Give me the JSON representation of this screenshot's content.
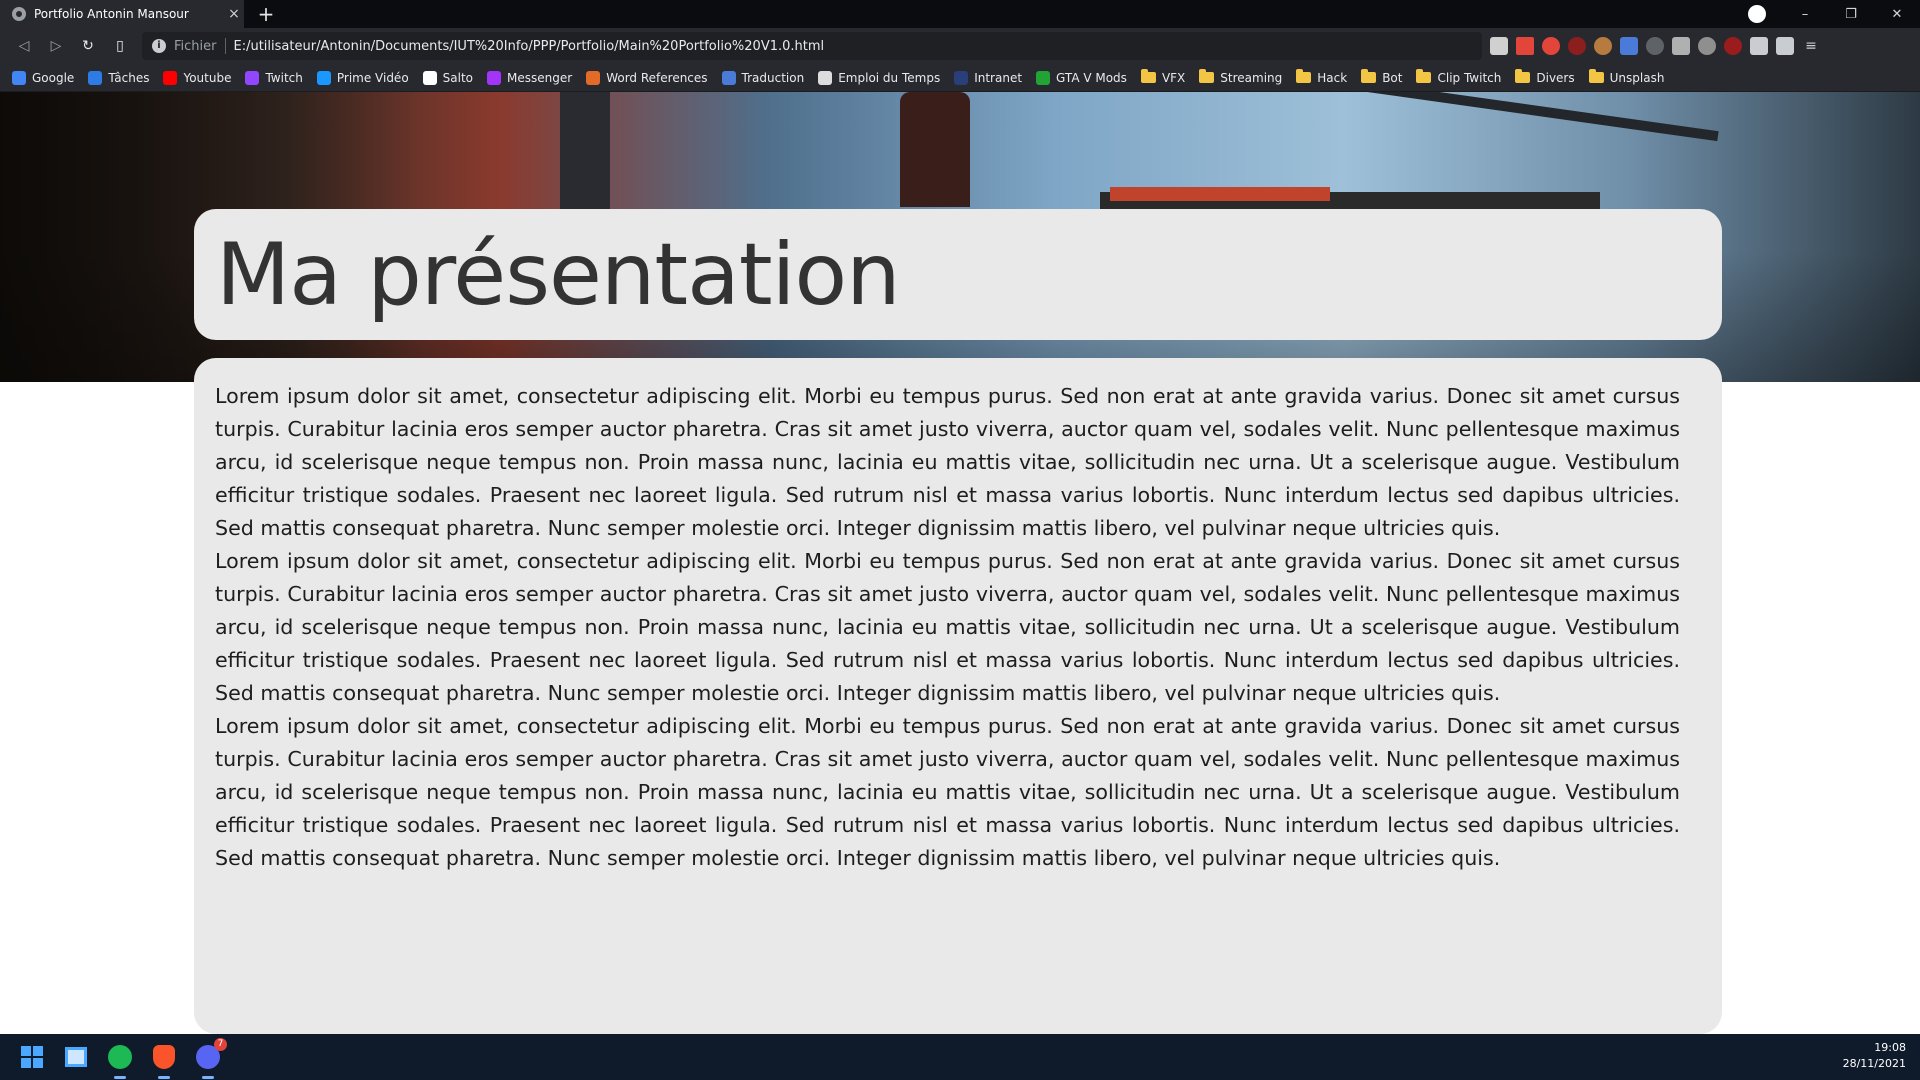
{
  "browser": {
    "tab_title": "Portfolio Antonin Mansour",
    "tab_close": "×",
    "new_tab": "+",
    "address_scheme": "Fichier",
    "address_url": "E:/utilisateur/Antonin/Documents/IUT%20Info/PPP/Portfolio/Main%20Portfolio%20V1.0.html",
    "window_controls": {
      "minimize": "–",
      "restore": "❐",
      "close": "✕"
    },
    "bookmarks": [
      {
        "label": "Google",
        "icon": "google-icon",
        "color": "#4285f4"
      },
      {
        "label": "Tâches",
        "icon": "tasks-icon",
        "color": "#2d7be5"
      },
      {
        "label": "Youtube",
        "icon": "youtube-icon",
        "color": "#ff0000"
      },
      {
        "label": "Twitch",
        "icon": "twitch-icon",
        "color": "#9146ff"
      },
      {
        "label": "Prime Vidéo",
        "icon": "prime-video-icon",
        "color": "#1a98ff"
      },
      {
        "label": "Salto",
        "icon": "salto-icon",
        "color": "#ffffff"
      },
      {
        "label": "Messenger",
        "icon": "messenger-icon",
        "color": "#a334fa"
      },
      {
        "label": "Word References",
        "icon": "wordreference-icon",
        "color": "#e26b2a"
      },
      {
        "label": "Traduction",
        "icon": "translate-icon",
        "color": "#4a7bd8"
      },
      {
        "label": "Emploi du Temps",
        "icon": "calendar-icon",
        "color": "#dddddd"
      },
      {
        "label": "Intranet",
        "icon": "intranet-icon",
        "color": "#2a3e7a"
      },
      {
        "label": "GTA V Mods",
        "icon": "gtav-mods-icon",
        "color": "#21a336"
      },
      {
        "label": "VFX",
        "icon": "folder-icon",
        "color": "#f3c544"
      },
      {
        "label": "Streaming",
        "icon": "folder-icon",
        "color": "#f3c544"
      },
      {
        "label": "Hack",
        "icon": "folder-icon",
        "color": "#f3c544"
      },
      {
        "label": "Bot",
        "icon": "folder-icon",
        "color": "#f3c544"
      },
      {
        "label": "Clip Twitch",
        "icon": "folder-icon",
        "color": "#f3c544"
      },
      {
        "label": "Divers",
        "icon": "folder-icon",
        "color": "#f3c544"
      },
      {
        "label": "Unsplash",
        "icon": "folder-icon",
        "color": "#f3c544"
      }
    ]
  },
  "page": {
    "heading": "Ma présentation",
    "paragraphs": [
      "Lorem ipsum dolor sit amet, consectetur adipiscing elit. Morbi eu tempus purus. Sed non erat at ante gravida varius. Donec sit amet cursus turpis. Curabitur lacinia eros semper auctor pharetra. Cras sit amet justo viverra, auctor quam vel, sodales velit. Nunc pellentesque maximus arcu, id scelerisque neque tempus non. Proin massa nunc, lacinia eu mattis vitae, sollicitudin nec urna. Ut a scelerisque augue. Vestibulum efficitur tristique sodales. Praesent nec laoreet ligula. Sed rutrum nisl et massa varius lobortis. Nunc interdum lectus sed dapibus ultricies. Sed mattis consequat pharetra. Nunc semper molestie orci. Integer dignissim mattis libero, vel pulvinar neque ultricies quis.",
      "Lorem ipsum dolor sit amet, consectetur adipiscing elit. Morbi eu tempus purus. Sed non erat at ante gravida varius. Donec sit amet cursus turpis. Curabitur lacinia eros semper auctor pharetra. Cras sit amet justo viverra, auctor quam vel, sodales velit. Nunc pellentesque maximus arcu, id scelerisque neque tempus non. Proin massa nunc, lacinia eu mattis vitae, sollicitudin nec urna. Ut a scelerisque augue. Vestibulum efficitur tristique sodales. Praesent nec laoreet ligula. Sed rutrum nisl et massa varius lobortis. Nunc interdum lectus sed dapibus ultricies. Sed mattis consequat pharetra. Nunc semper molestie orci. Integer dignissim mattis libero, vel pulvinar neque ultricies quis.",
      "Lorem ipsum dolor sit amet, consectetur adipiscing elit. Morbi eu tempus purus. Sed non erat at ante gravida varius. Donec sit amet cursus turpis. Curabitur lacinia eros semper auctor pharetra. Cras sit amet justo viverra, auctor quam vel, sodales velit. Nunc pellentesque maximus arcu, id scelerisque neque tempus non. Proin massa nunc, lacinia eu mattis vitae, sollicitudin nec urna. Ut a scelerisque augue. Vestibulum efficitur tristique sodales. Praesent nec laoreet ligula. Sed rutrum nisl et massa varius lobortis. Nunc interdum lectus sed dapibus ultricies. Sed mattis consequat pharetra. Nunc semper molestie orci. Integer dignissim mattis libero, vel pulvinar neque ultricies quis."
    ]
  },
  "taskbar": {
    "apps": [
      {
        "name": "start-button",
        "icon": "windows-icon"
      },
      {
        "name": "widgets-button",
        "icon": "widgets-icon"
      },
      {
        "name": "spotify-button",
        "icon": "spotify-icon",
        "color": "#1db954"
      },
      {
        "name": "brave-button",
        "icon": "brave-icon",
        "color": "#fb542b"
      },
      {
        "name": "discord-button",
        "icon": "discord-icon",
        "color": "#5865f2",
        "badge": "7"
      }
    ],
    "time": "19:08",
    "date": "28/11/2021"
  }
}
